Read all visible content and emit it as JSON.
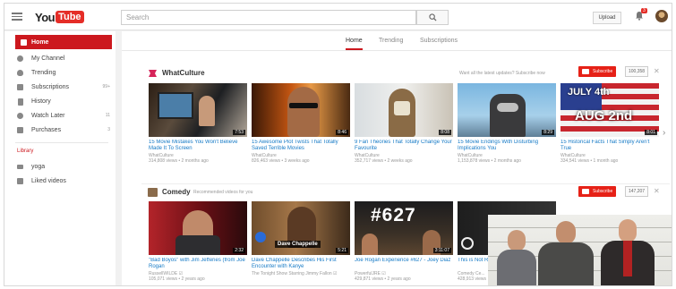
{
  "header": {
    "logo_you": "You",
    "logo_tube": "Tube",
    "search_placeholder": "Search",
    "upload_label": "Upload",
    "notification_count": "3"
  },
  "sidebar": {
    "items": [
      {
        "label": "Home",
        "icon": "home-icon",
        "count": ""
      },
      {
        "label": "My Channel",
        "icon": "person-icon",
        "count": ""
      },
      {
        "label": "Trending",
        "icon": "flame-icon",
        "count": ""
      },
      {
        "label": "Subscriptions",
        "icon": "subscriptions-icon",
        "count": "99+"
      },
      {
        "label": "History",
        "icon": "history-icon",
        "count": ""
      },
      {
        "label": "Watch Later",
        "icon": "clock-icon",
        "count": "11"
      },
      {
        "label": "Purchases",
        "icon": "cart-icon",
        "count": "3"
      }
    ],
    "library_heading": "Library",
    "library_items": [
      {
        "label": "yoga",
        "icon": "playlist-icon"
      },
      {
        "label": "Liked videos",
        "icon": "thumbs-up-icon"
      }
    ]
  },
  "tabs": [
    "Home",
    "Trending",
    "Subscriptions"
  ],
  "shelves": [
    {
      "title": "WhatCulture",
      "subtitle": "",
      "prompt": "Want all the latest updates? Subscribe now",
      "subscribe_label": "Subscribe",
      "subscriber_count": "100,358",
      "videos": [
        {
          "title": "15 Movie Mistakes You Won't Believe Made It To Screen",
          "channel": "WhatCulture",
          "meta": "314,808 views • 2 months ago",
          "duration": "7:53"
        },
        {
          "title": "15 Awesome Plot Twists That Totally Saved Terrible Movies",
          "channel": "WhatCulture",
          "meta": "826,463 views • 3 weeks ago",
          "duration": "8:46"
        },
        {
          "title": "9 Fan Theories That Totally Change Your Favourite",
          "channel": "WhatCulture",
          "meta": "352,717 views • 2 weeks ago",
          "duration": "8:08"
        },
        {
          "title": "15 Movie Endings With Disturbing Implications You",
          "channel": "WhatCulture",
          "meta": "1,153,878 views • 2 months ago",
          "duration": "8:29"
        },
        {
          "title": "15 Historical Facts That Simply Aren't True",
          "channel": "WhatCulture",
          "meta": "334,541 views • 1 month ago",
          "duration": "8:01",
          "overlay_line1": "JULY 4th",
          "overlay_line2": "AUG 2nd"
        }
      ]
    },
    {
      "title": "Comedy",
      "subtitle": "Recommended videos for you",
      "prompt": "",
      "subscribe_label": "Subscribe",
      "subscriber_count": "147,207",
      "videos": [
        {
          "title": "\"Bad Boyos\" with Jim Jefferies (from Joe Rogan",
          "channel": "RussellWILDE ☑",
          "meta": "105,071 views • 2 years ago",
          "duration": "2:32"
        },
        {
          "title": "Dave Chappelle Describes His First Encounter with Kanye",
          "channel": "The Tonight Show Starring Jimmy Fallon ☑",
          "meta": "",
          "duration": "5:21",
          "overlay_line1": "Dave Chappelle"
        },
        {
          "title": "Joe Rogan Experience #627 - Joey Diaz",
          "channel": "PowerfulJRE ☑",
          "meta": "429,871 views • 2 years ago",
          "duration": "3:11:07",
          "overlay_line1": "#627"
        },
        {
          "title": "This is Not Rogan - Her",
          "channel": "Comedy Ce...",
          "meta": "428,913 views",
          "duration": ""
        }
      ]
    }
  ],
  "colors": {
    "brand_red": "#e52d27",
    "sidebar_active": "#cc181e",
    "link_blue": "#167ac6"
  }
}
